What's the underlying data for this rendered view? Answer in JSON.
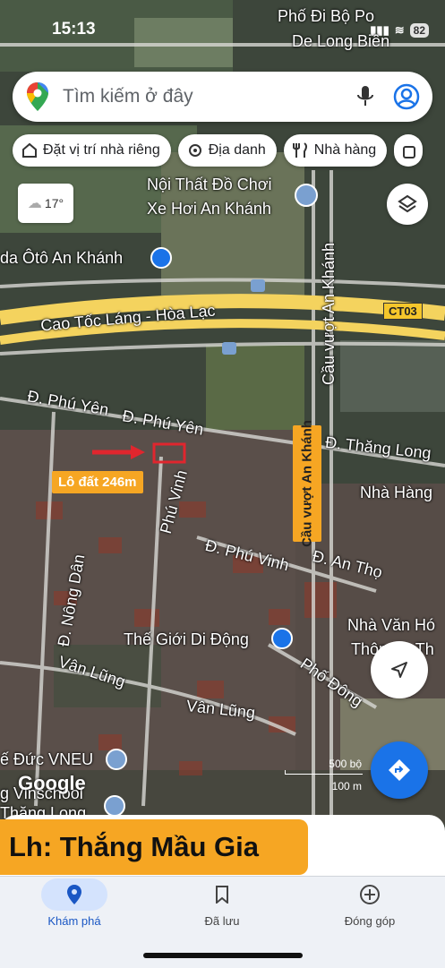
{
  "status_bar": {
    "time": "15:13",
    "battery": "82"
  },
  "search": {
    "placeholder": "Tìm kiếm ở đây"
  },
  "chips": [
    {
      "label": "Đặt vị trí nhà riêng",
      "icon": "home-icon"
    },
    {
      "label": "Địa danh",
      "icon": "landmark-icon"
    },
    {
      "label": "Nhà hàng",
      "icon": "restaurant-icon"
    }
  ],
  "weather": {
    "temp": "17°",
    "icon": "cloud-icon"
  },
  "map_labels": {
    "pho_di_bo": "Phố Đi Bộ Po",
    "de_long_bien": "De Long Biên",
    "noi_that_1": "Nội Thất Đồ Chơi",
    "noi_that_2": "Xe Hơi An Khánh",
    "oto_an_khanh": "da Ôtô An Khánh",
    "cao_toc": "Cao Tốc Láng - Hòa Lạc",
    "ct03": "CT03",
    "cau_vuot_1": "Cầu vượt An Khánh",
    "cau_vuot_2": "Cầu vượt An Khánh",
    "phu_yen_1": "Đ. Phú Yên",
    "phu_yen_2": "Đ. Phú Yên",
    "thang_long": "Đ. Thăng Long",
    "nha_hang": "Nhà Hàng",
    "lot": "Lô đất 246m",
    "phu_vinh": "Phú Vinh",
    "d_phu_vinh": "Đ. Phú Vinh",
    "an_tho": "Đ. An Thọ",
    "nong_dan": "Đ. Nông Dân",
    "the_gioi": "Thế Giới Di Động",
    "nha_van_hoa_1": "Nhà Văn Hó",
    "nha_van_hoa_2": "Thôn An Th",
    "van_lung_1": "Vân Lũng",
    "van_lung_2": "Vân Lũng",
    "pho_dong": "Phố Đông",
    "duc_vneu": "ế Đức VNEU",
    "vinschool": "g Vinschool",
    "thang_long_2": "Thăng Long"
  },
  "scale": {
    "ft": "500 bộ",
    "m": "100 m"
  },
  "google_logo": "Google",
  "contact_banner": "Lh: Thắng Mầu Gia",
  "bottom_nav": [
    {
      "label": "Khám phá",
      "icon": "explore-pin-icon",
      "active": true
    },
    {
      "label": "Đã lưu",
      "icon": "bookmark-icon",
      "active": false
    },
    {
      "label": "Đóng góp",
      "icon": "add-circle-icon",
      "active": false
    }
  ]
}
